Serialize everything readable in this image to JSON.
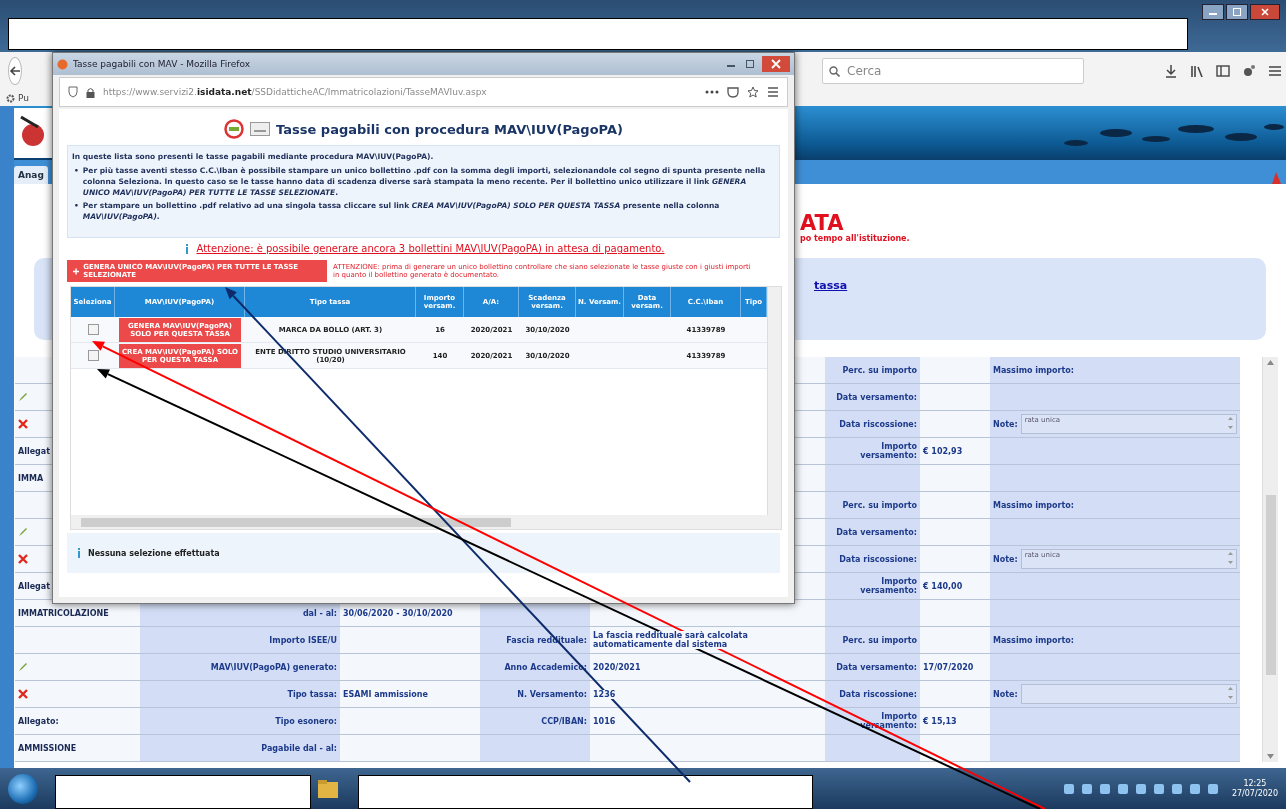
{
  "browser": {
    "bookmark": "Pu",
    "search": {
      "placeholder": "Cerca"
    }
  },
  "page": {
    "nav_tab": "Anag",
    "title": "ATA",
    "subtitle": "po tempo all'istituzione.",
    "link": "tassa",
    "table": {
      "rows": [
        [
          {
            "kind": "blank"
          },
          {
            "kind": "blank"
          },
          {
            "kind": "blank"
          },
          {
            "kind": "blank"
          },
          {
            "kind": "blank"
          },
          {
            "kind": "label",
            "text": "Perc. su importo"
          },
          {
            "kind": "blank"
          },
          {
            "kind": "label",
            "text": "Massimo importo:"
          }
        ],
        [
          {
            "kind": "check"
          },
          {
            "kind": "blank"
          },
          {
            "kind": "blank"
          },
          {
            "kind": "blank"
          },
          {
            "kind": "blank"
          },
          {
            "kind": "label",
            "text": "Data versamento:"
          },
          {
            "kind": "blank"
          },
          {
            "kind": "blank"
          }
        ],
        [
          {
            "kind": "cross"
          },
          {
            "kind": "blank"
          },
          {
            "kind": "blank"
          },
          {
            "kind": "blank"
          },
          {
            "kind": "blank"
          },
          {
            "kind": "label",
            "text": "Data riscossione:"
          },
          {
            "kind": "blank"
          },
          {
            "kind": "note",
            "label": "Note:",
            "value": "rata unica"
          }
        ],
        [
          {
            "kind": "head",
            "text": "Allegat"
          },
          {
            "kind": "blank"
          },
          {
            "kind": "blank"
          },
          {
            "kind": "blank"
          },
          {
            "kind": "blank"
          },
          {
            "kind": "label",
            "text": "Importo versamento:"
          },
          {
            "kind": "value",
            "text": "€ 102,93"
          },
          {
            "kind": "blank"
          }
        ],
        [
          {
            "kind": "head",
            "text": "IMMA"
          },
          {
            "kind": "blank"
          },
          {
            "kind": "blank"
          },
          {
            "kind": "blank"
          },
          {
            "kind": "blank"
          },
          {
            "kind": "blank"
          },
          {
            "kind": "blank"
          },
          {
            "kind": "blank"
          }
        ],
        [
          {
            "kind": "blank"
          },
          {
            "kind": "blank"
          },
          {
            "kind": "blank"
          },
          {
            "kind": "blank"
          },
          {
            "kind": "blank"
          },
          {
            "kind": "label",
            "text": "Perc. su importo"
          },
          {
            "kind": "blank"
          },
          {
            "kind": "label",
            "text": "Massimo importo:"
          }
        ],
        [
          {
            "kind": "check"
          },
          {
            "kind": "blank"
          },
          {
            "kind": "blank"
          },
          {
            "kind": "blank"
          },
          {
            "kind": "blank"
          },
          {
            "kind": "label",
            "text": "Data versamento:"
          },
          {
            "kind": "blank"
          },
          {
            "kind": "blank"
          }
        ],
        [
          {
            "kind": "cross"
          },
          {
            "kind": "blank"
          },
          {
            "kind": "blank"
          },
          {
            "kind": "blank"
          },
          {
            "kind": "blank"
          },
          {
            "kind": "label",
            "text": "Data riscossione:"
          },
          {
            "kind": "blank"
          },
          {
            "kind": "note",
            "label": "Note:",
            "value": "rata unica"
          }
        ],
        [
          {
            "kind": "head",
            "text": "Allegat"
          },
          {
            "kind": "blank"
          },
          {
            "kind": "blank"
          },
          {
            "kind": "blank"
          },
          {
            "kind": "blank"
          },
          {
            "kind": "label",
            "text": "Importo versamento:"
          },
          {
            "kind": "value",
            "text": "€ 140,00"
          },
          {
            "kind": "blank"
          }
        ],
        [
          {
            "kind": "head",
            "text": "IMMATRICOLAZIONE"
          },
          {
            "kind": "label",
            "text": "dal - al:"
          },
          {
            "kind": "value",
            "text": "30/06/2020 - 30/10/2020"
          },
          {
            "kind": "blank"
          },
          {
            "kind": "blank"
          },
          {
            "kind": "blank"
          },
          {
            "kind": "blank"
          },
          {
            "kind": "blank"
          }
        ],
        [
          {
            "kind": "blank"
          },
          {
            "kind": "label",
            "text": "Importo ISEE/U"
          },
          {
            "kind": "blank"
          },
          {
            "kind": "label",
            "text": "Fascia reddituale:"
          },
          {
            "kind": "value",
            "text": "La fascia reddituale sarà calcolata automaticamente dal sistema"
          },
          {
            "kind": "label",
            "text": "Perc. su importo"
          },
          {
            "kind": "blank"
          },
          {
            "kind": "label",
            "text": "Massimo importo:"
          }
        ],
        [
          {
            "kind": "check"
          },
          {
            "kind": "label",
            "text": "MAV\\IUV(PagoPA) generato:"
          },
          {
            "kind": "blank"
          },
          {
            "kind": "label",
            "text": "Anno Accademico:"
          },
          {
            "kind": "value",
            "text": "2020/2021"
          },
          {
            "kind": "label",
            "text": "Data versamento:"
          },
          {
            "kind": "value",
            "text": "17/07/2020"
          },
          {
            "kind": "blank"
          }
        ],
        [
          {
            "kind": "cross"
          },
          {
            "kind": "label",
            "text": "Tipo tassa:"
          },
          {
            "kind": "value",
            "text": "ESAMI ammissione"
          },
          {
            "kind": "label",
            "text": "N. Versamento:"
          },
          {
            "kind": "value",
            "text": "1236"
          },
          {
            "kind": "label",
            "text": "Data riscossione:"
          },
          {
            "kind": "blank"
          },
          {
            "kind": "note",
            "label": "Note:"
          }
        ],
        [
          {
            "kind": "head",
            "text": "Allegato:"
          },
          {
            "kind": "label",
            "text": "Tipo esonero:"
          },
          {
            "kind": "blank"
          },
          {
            "kind": "label",
            "text": "CCP/IBAN:"
          },
          {
            "kind": "value",
            "text": "1016"
          },
          {
            "kind": "label",
            "text": "Importo versamento:"
          },
          {
            "kind": "value",
            "text": "€ 15,13"
          },
          {
            "kind": "blank"
          }
        ],
        [
          {
            "kind": "head",
            "text": "AMMISSIONE"
          },
          {
            "kind": "label",
            "text": "Pagabile dal - al:"
          },
          {
            "kind": "blank"
          },
          {
            "kind": "blank"
          },
          {
            "kind": "blank"
          },
          {
            "kind": "blank"
          },
          {
            "kind": "blank"
          },
          {
            "kind": "blank"
          }
        ]
      ]
    }
  },
  "popup": {
    "window_title": "Tasse pagabili con MAV - Mozilla Firefox",
    "url": "https://www.servizi2.**isidata.net**/SSDidatticheAC/Immatricolazioni/TasseMAVIuv.aspx",
    "heading": "Tasse pagabili con procedura MAV\\IUV(PagoPA)",
    "intro": "In queste lista sono presenti le tasse pagabili mediante procedura MAV\\IUV(PagoPA).",
    "bullets": [
      {
        "marker": "•",
        "text": "Per più tasse aventi stesso C.C.\\Iban è possibile stampare un unico bollettino .pdf con la somma degli importi, selezionandole col segno di spunta presente nella colonna Seleziona. In questo caso se le tasse hanno data di scadenza diverse sarà stampata la meno recente. Per il bollettino unico utilizzare il link *GENERA UNICO MAV\\IUV(PagoPA) PER TUTTE LE TASSE SELEZIONATE*."
      },
      {
        "marker": "•",
        "text": "Per stampare un bollettino .pdf relativo ad una singola tassa cliccare sul link *CREA MAV\\IUV(PagoPA) SOLO PER QUESTA TASSA* presente nella colonna *MAV\\IUV(PagoPA)*."
      }
    ],
    "warning": "Attenzione: è possibile generare ancora 3 bollettini MAV\\IUV(PagoPA) in attesa di pagamento.",
    "generate_button": "GENERA UNICO MAV\\IUV(PagoPA) PER TUTTE LE TASSE SELEZIONATE",
    "attention": "ATTENZIONE: prima di generare un unico bollettino controllare che siano selezionate le tasse giuste con i giusti importi in quanto il bollettino generato è documentato.",
    "table": {
      "columns": [
        "Seleziona",
        "MAV\\IUV(PagoPA)",
        "Tipo tassa",
        "Importo versam.",
        "A/A:",
        "Scadenza versam.",
        "N. Versam.",
        "Data versam.",
        "C.C.\\Iban",
        "Tipo"
      ],
      "rows": [
        {
          "checked": false,
          "button": "GENERA MAV\\IUV(PagoPA) SOLO PER QUESTA TASSA",
          "tipo_tassa": "MARCA DA BOLLO (ART. 3)",
          "importo": "16",
          "anno": "2020/2021",
          "scadenza": "30/10/2020",
          "iban": "41339789"
        },
        {
          "checked": false,
          "button": "CREA MAV\\IUV(PagoPA) SOLO PER QUESTA TASSA",
          "tipo_tassa": "ENTE DIRITTO STUDIO UNIVERSITARIO (10/20)",
          "importo": "140",
          "anno": "2020/2021",
          "scadenza": "30/10/2020",
          "iban": "41339789"
        }
      ]
    },
    "footer": "Nessuna selezione effettuata"
  },
  "taskbar": {
    "time": "12:25",
    "date": "27/07/2020"
  },
  "annotations": [
    {
      "color": "#0d2a6b"
    },
    {
      "color": "#ff0000"
    },
    {
      "color": "#000000"
    }
  ]
}
